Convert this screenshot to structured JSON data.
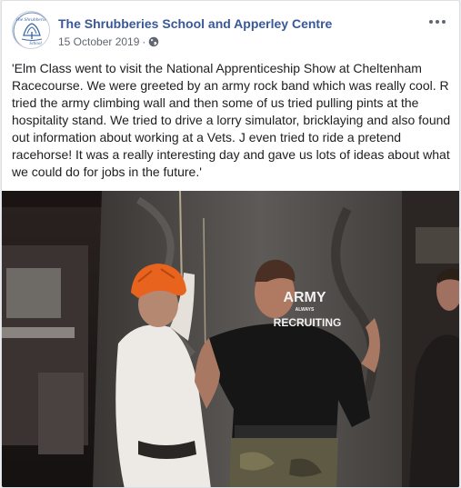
{
  "post": {
    "page_name": "The Shrubberies School and Apperley Centre",
    "date": "15 October 2019",
    "separator": "·",
    "privacy_icon": "globe-icon",
    "more_icon": "more-options-icon",
    "body": "'Elm Class went to visit the National Apprenticeship Show at Cheltenham Racecourse. We were greeted by an army rock band which was really cool. R tried the army climbing wall and then some of us tried pulling pints at the hospitality stand. We tried to drive a lorry simulator, bricklaying and also found out information about working at a Vets. J even tried to ride a pretend racehorse! It was a really interesting day and gave us lots of ideas about what we could do for jobs in the future.'"
  },
  "logo": {
    "text_top": "The Shrubberies",
    "text_bottom": "School"
  },
  "photo": {
    "shirt_text_main": "ARMY",
    "shirt_text_small": "ALWAYS",
    "shirt_text_bottom": "RECRUITING"
  },
  "colors": {
    "link": "#385898",
    "text": "#1c1e21",
    "meta": "#606770",
    "helmet": "#e8641e"
  }
}
